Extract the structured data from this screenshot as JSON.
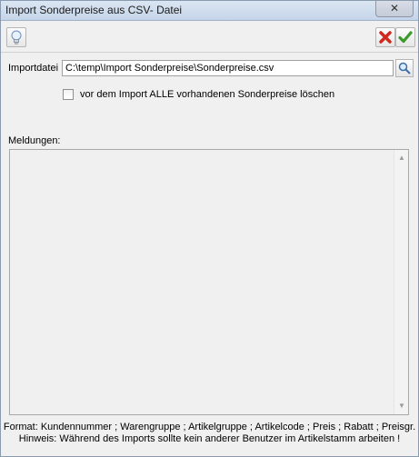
{
  "window": {
    "title": "Import Sonderpreise aus CSV- Datei",
    "close_label": "✕"
  },
  "toolbar": {
    "hint_icon": "lightbulb-icon",
    "cancel_icon": "red-x-icon",
    "ok_icon": "green-check-icon"
  },
  "form": {
    "importfile_label": "Importdatei",
    "importfile_value": "C:\\temp\\Import Sonderpreise\\Sonderpreise.csv",
    "browse_icon": "magnifier-icon",
    "delete_checkbox_label": "vor dem Import ALLE vorhandenen Sonderpreise löschen",
    "delete_checked": false
  },
  "messages": {
    "label": "Meldungen:",
    "content": ""
  },
  "footer": {
    "format_line": "Format: Kundennummer ; Warengruppe ; Artikelgruppe ; Artikelcode ; Preis ; Rabatt ; Preisgr.",
    "hint_line": "Hinweis: Während des Imports sollte  kein anderer Benutzer im Artikelstamm arbeiten !"
  },
  "colors": {
    "cancel": "#d0281e",
    "ok": "#3a9a2a",
    "titlebar": "#c9d8ec"
  }
}
